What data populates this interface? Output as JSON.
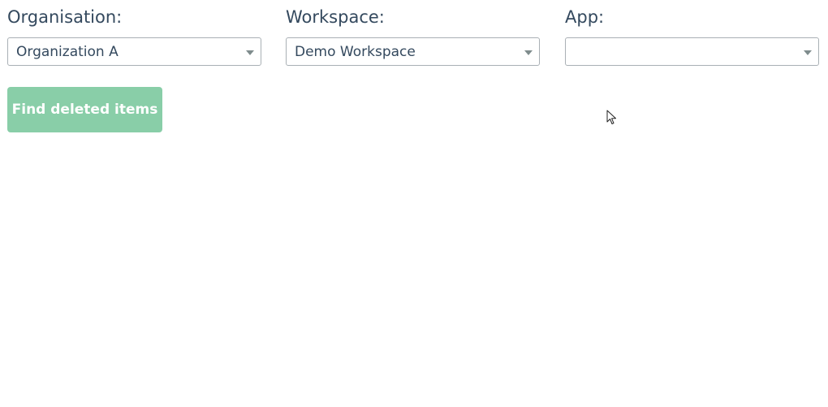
{
  "organisation": {
    "label": "Organisation:",
    "selected": "Organization A"
  },
  "workspace": {
    "label": "Workspace:",
    "selected": "Demo Workspace"
  },
  "app": {
    "label": "App:",
    "selected": ""
  },
  "actions": {
    "find_deleted_label": "Find deleted items"
  },
  "icons": {
    "dropdown_caret": "chevron-down-icon",
    "mouse_cursor": "pointer-cursor-icon"
  },
  "colors": {
    "primary_button": "#89cea8",
    "label_text": "#34495e"
  }
}
